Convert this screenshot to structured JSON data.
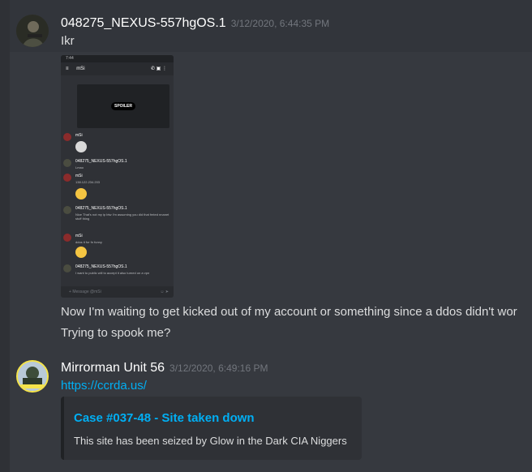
{
  "messages": [
    {
      "username": "048275_NEXUS-557hgOS.1",
      "timestamp": "3/12/2020, 6:44:35 PM",
      "first_line": "Ikr",
      "attachment": {
        "status_time": "7:44",
        "channel": "mSi",
        "spoiler_label": "SPOILER",
        "rows": [
          {
            "name": "mSi",
            "text": ""
          },
          {
            "name": "048275_NEXUS-557hgOS.1",
            "text": "Lmao"
          },
          {
            "name": "mSi",
            "text": "138.122.234.203"
          },
          {
            "name": "048275_NEXUS-557hgOS.1",
            "text": "Nice That's not my ip btw I'm assuming you did that fmted nnanet stuff thing"
          },
          {
            "name": "mSi",
            "text": "ddos it for fn funny"
          },
          {
            "name": "048275_NEXUS-557hgOS.1",
            "text": "I want to public will to accept it also turned on a vpn"
          }
        ],
        "input_placeholder": "Message @mSi"
      },
      "lines": [
        "Now I'm waiting to get kicked out of my account or something  since a ddos didn't wor",
        "Trying to spook me?"
      ]
    },
    {
      "username": "Mirrorman Unit 56",
      "timestamp": "3/12/2020, 6:49:16 PM",
      "link": "https://ccrda.us/",
      "embed": {
        "title": "Case #037-48 - Site taken down",
        "description": "This site has been seized by Glow in the Dark CIA Niggers"
      }
    }
  ]
}
